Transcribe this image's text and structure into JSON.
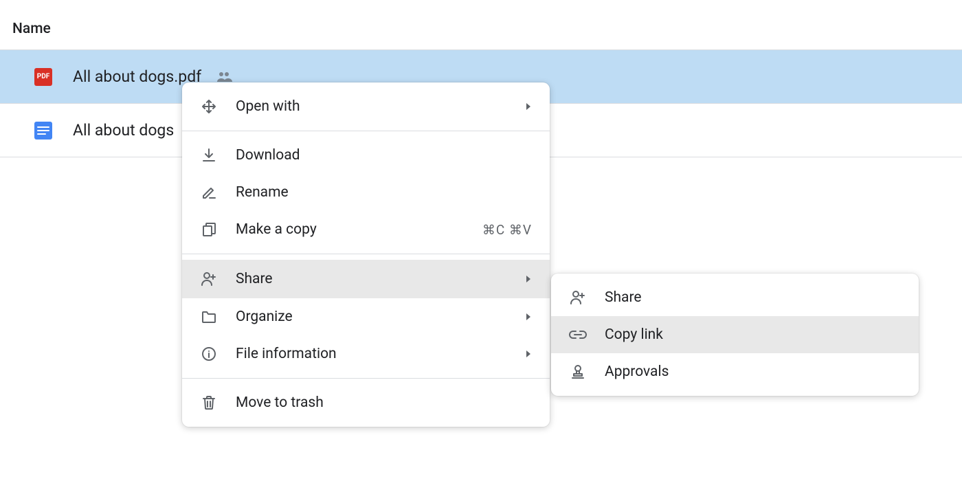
{
  "header": "Name",
  "files": [
    {
      "name": "All about dogs.pdf",
      "type": "pdf",
      "shared": true
    },
    {
      "name": "All about dogs",
      "type": "doc",
      "shared": false
    }
  ],
  "menu": {
    "open_with": "Open with",
    "download": "Download",
    "rename": "Rename",
    "make_copy": "Make a copy",
    "make_copy_shortcut": "⌘C ⌘V",
    "share": "Share",
    "organize": "Organize",
    "file_info": "File information",
    "trash": "Move to trash"
  },
  "submenu": {
    "share": "Share",
    "copy_link": "Copy link",
    "approvals": "Approvals"
  },
  "pdf_label": "PDF"
}
